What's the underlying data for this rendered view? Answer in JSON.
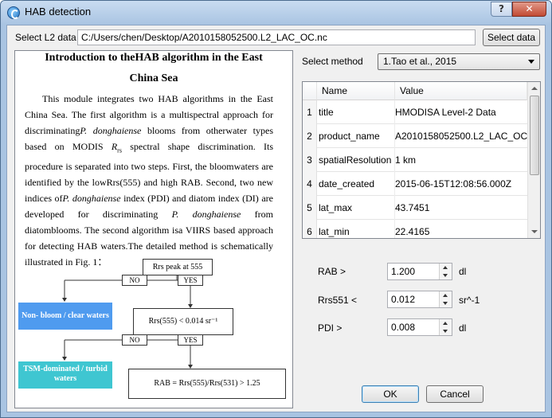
{
  "window": {
    "title": "HAB detection",
    "help_label": "?",
    "close_label": "✕"
  },
  "file": {
    "label": "Select L2 data",
    "path": "C:/Users/chen/Desktop/A2010158052500.L2_LAC_OC.nc",
    "select_button": "Select data"
  },
  "intro": {
    "title_line1": "Introduction to theHAB algorithm in the East",
    "title_line2": "China Sea",
    "p_a": "This module integrates two HAB algorithms in the East China Sea. The first algorithm is a multispectral approach for discriminating",
    "p_a_species": "P. donghaiense",
    "p_b": " blooms from otherwater types based on MODIS ",
    "p_b_rrs": "R",
    "p_b_rrs_sub": "rs",
    "p_c": " spectral shape discrimination. Its procedure is separated into two steps. First, the bloomwaters are identified by the lowRrs(555) and high RAB. Second, two new indices of",
    "p_c_species": "P. donghaiense",
    "p_d": " index (PDI) and diatom index (DI) are developed for discriminating ",
    "p_d_species": "P. donghaiense",
    "p_e": " from diatomblooms. The second algorithm isa VIIRS based approach for detecting HAB waters.The detailed method is schematically illustrated in Fig. 1："
  },
  "flowchart": {
    "step1": "Rrs peak at 555",
    "no1": "NO",
    "yes1": "YES",
    "nonbloom": "Non- bloom / clear waters",
    "step2": "Rrs(555) < 0.014 sr⁻¹",
    "no2": "NO",
    "yes2": "YES",
    "tsm": "TSM-dominated / turbid waters",
    "step3": "RAB = Rrs(555)/Rrs(531) > 1.25",
    "colors": {
      "nonbloom": "#4f9bef",
      "tsm": "#3fc6d1"
    }
  },
  "method": {
    "label": "Select method",
    "selected": "1.Tao et al., 2015"
  },
  "metadata_table": {
    "headers": [
      "Name",
      "Value"
    ],
    "rows": [
      {
        "num": "1",
        "name": "title",
        "value": "HMODISA Level-2 Data"
      },
      {
        "num": "2",
        "name": "product_name",
        "value": "A2010158052500.L2_LAC_OC.nc"
      },
      {
        "num": "3",
        "name": "spatialResolution",
        "value": "1 km"
      },
      {
        "num": "4",
        "name": "date_created",
        "value": "2015-06-15T12:08:56.000Z"
      },
      {
        "num": "5",
        "name": "lat_max",
        "value": "43.7451"
      },
      {
        "num": "6",
        "name": "lat_min",
        "value": "22.4165"
      }
    ]
  },
  "params": {
    "rab": {
      "label": "RAB >",
      "value": "1.200",
      "unit": "dl"
    },
    "rrs551": {
      "label": "Rrs551 <",
      "value": "0.012",
      "unit": "sr^-1"
    },
    "pdi": {
      "label": "PDI >",
      "value": "0.008",
      "unit": "dl"
    }
  },
  "actions": {
    "ok": "OK",
    "cancel": "Cancel"
  }
}
